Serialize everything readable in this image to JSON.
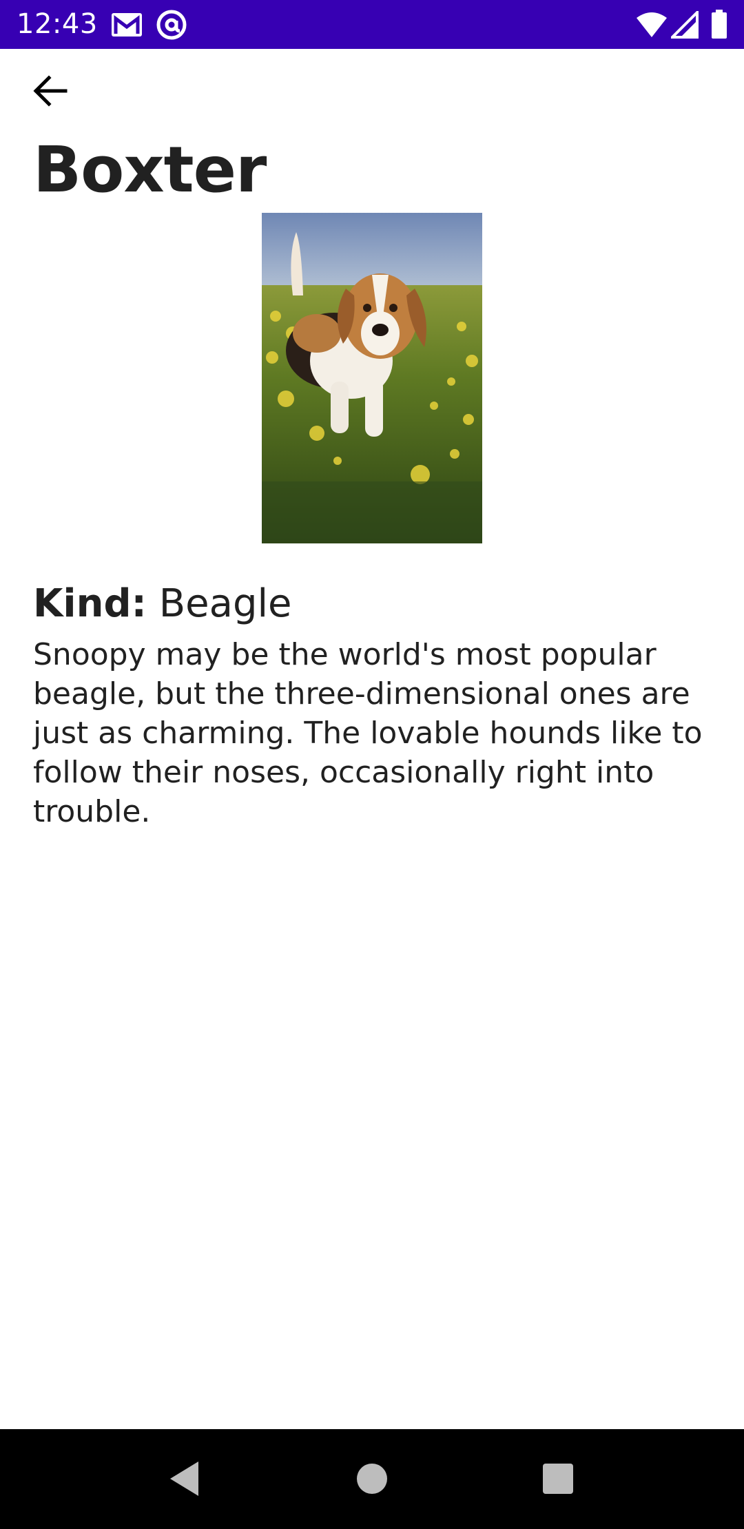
{
  "status_bar": {
    "time": "12:43",
    "icons": [
      "gmail-icon",
      "at-sign-icon",
      "wifi-icon",
      "signal-icon",
      "battery-icon"
    ],
    "background_color": "#3700B3"
  },
  "header": {
    "back_icon": "arrow-back-icon",
    "title": "Boxter"
  },
  "pet": {
    "photo_subject": "beagle in a field of yellow flowers",
    "kind_label": "Kind:",
    "kind_value": "Beagle",
    "description": "Snoopy may be the world's most popular beagle, but the three-dimensional ones are just as charming. The lovable hounds like to follow their noses, occasionally right into trouble."
  },
  "nav_bar": {
    "icons": [
      "nav-back-icon",
      "nav-home-icon",
      "nav-recents-icon"
    ]
  }
}
